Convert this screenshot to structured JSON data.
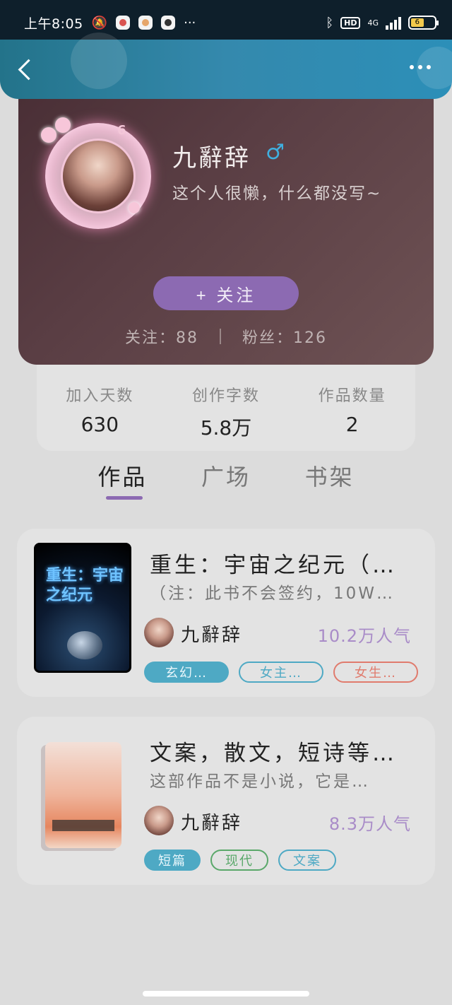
{
  "status_bar": {
    "time": "上午8:05",
    "more": "···",
    "hd": "HD",
    "network": "4G",
    "battery": "6"
  },
  "header": {
    "back_icon": "chevron-left",
    "more_icon": "ellipsis"
  },
  "profile": {
    "level": "6",
    "username": "九辭辞",
    "gender_symbol": "♂",
    "bio": "这个人很懒，什么都没写~",
    "follow_button": "+ 关注",
    "following_label": "关注：88",
    "followers_label": "粉丝：126"
  },
  "stats": [
    {
      "label": "加入天数",
      "value": "630"
    },
    {
      "label": "创作字数",
      "value": "5.8万"
    },
    {
      "label": "作品数量",
      "value": "2"
    }
  ],
  "tabs": [
    "作品",
    "广场",
    "书架"
  ],
  "books": [
    {
      "title": "重生：宇宙之纪元（…",
      "description": "（注：此书不会签约，10W…",
      "cover_text": "重生：宇宙之纪元",
      "author": "九辭辞",
      "popularity": "10.2万人气",
      "tags": [
        "玄幻…",
        "女主…",
        "女生…"
      ]
    },
    {
      "title": "文案，散文，短诗等…",
      "description": "这部作品不是小说，它是…",
      "author": "九辭辞",
      "popularity": "8.3万人气",
      "tags": [
        "短篇",
        "现代",
        "文案"
      ]
    }
  ]
}
